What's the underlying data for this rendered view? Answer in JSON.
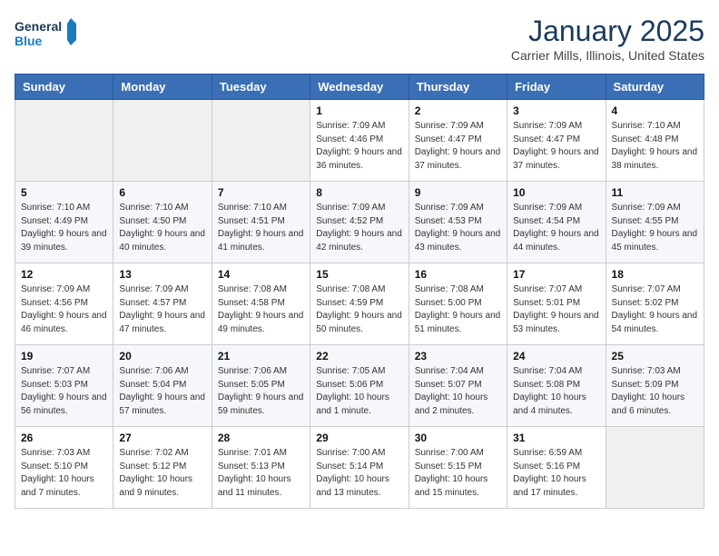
{
  "header": {
    "logo_line1": "General",
    "logo_line2": "Blue",
    "month_title": "January 2025",
    "location": "Carrier Mills, Illinois, United States"
  },
  "weekdays": [
    "Sunday",
    "Monday",
    "Tuesday",
    "Wednesday",
    "Thursday",
    "Friday",
    "Saturday"
  ],
  "weeks": [
    [
      {
        "day": "",
        "info": ""
      },
      {
        "day": "",
        "info": ""
      },
      {
        "day": "",
        "info": ""
      },
      {
        "day": "1",
        "info": "Sunrise: 7:09 AM\nSunset: 4:46 PM\nDaylight: 9 hours and 36 minutes."
      },
      {
        "day": "2",
        "info": "Sunrise: 7:09 AM\nSunset: 4:47 PM\nDaylight: 9 hours and 37 minutes."
      },
      {
        "day": "3",
        "info": "Sunrise: 7:09 AM\nSunset: 4:47 PM\nDaylight: 9 hours and 37 minutes."
      },
      {
        "day": "4",
        "info": "Sunrise: 7:10 AM\nSunset: 4:48 PM\nDaylight: 9 hours and 38 minutes."
      }
    ],
    [
      {
        "day": "5",
        "info": "Sunrise: 7:10 AM\nSunset: 4:49 PM\nDaylight: 9 hours and 39 minutes."
      },
      {
        "day": "6",
        "info": "Sunrise: 7:10 AM\nSunset: 4:50 PM\nDaylight: 9 hours and 40 minutes."
      },
      {
        "day": "7",
        "info": "Sunrise: 7:10 AM\nSunset: 4:51 PM\nDaylight: 9 hours and 41 minutes."
      },
      {
        "day": "8",
        "info": "Sunrise: 7:09 AM\nSunset: 4:52 PM\nDaylight: 9 hours and 42 minutes."
      },
      {
        "day": "9",
        "info": "Sunrise: 7:09 AM\nSunset: 4:53 PM\nDaylight: 9 hours and 43 minutes."
      },
      {
        "day": "10",
        "info": "Sunrise: 7:09 AM\nSunset: 4:54 PM\nDaylight: 9 hours and 44 minutes."
      },
      {
        "day": "11",
        "info": "Sunrise: 7:09 AM\nSunset: 4:55 PM\nDaylight: 9 hours and 45 minutes."
      }
    ],
    [
      {
        "day": "12",
        "info": "Sunrise: 7:09 AM\nSunset: 4:56 PM\nDaylight: 9 hours and 46 minutes."
      },
      {
        "day": "13",
        "info": "Sunrise: 7:09 AM\nSunset: 4:57 PM\nDaylight: 9 hours and 47 minutes."
      },
      {
        "day": "14",
        "info": "Sunrise: 7:08 AM\nSunset: 4:58 PM\nDaylight: 9 hours and 49 minutes."
      },
      {
        "day": "15",
        "info": "Sunrise: 7:08 AM\nSunset: 4:59 PM\nDaylight: 9 hours and 50 minutes."
      },
      {
        "day": "16",
        "info": "Sunrise: 7:08 AM\nSunset: 5:00 PM\nDaylight: 9 hours and 51 minutes."
      },
      {
        "day": "17",
        "info": "Sunrise: 7:07 AM\nSunset: 5:01 PM\nDaylight: 9 hours and 53 minutes."
      },
      {
        "day": "18",
        "info": "Sunrise: 7:07 AM\nSunset: 5:02 PM\nDaylight: 9 hours and 54 minutes."
      }
    ],
    [
      {
        "day": "19",
        "info": "Sunrise: 7:07 AM\nSunset: 5:03 PM\nDaylight: 9 hours and 56 minutes."
      },
      {
        "day": "20",
        "info": "Sunrise: 7:06 AM\nSunset: 5:04 PM\nDaylight: 9 hours and 57 minutes."
      },
      {
        "day": "21",
        "info": "Sunrise: 7:06 AM\nSunset: 5:05 PM\nDaylight: 9 hours and 59 minutes."
      },
      {
        "day": "22",
        "info": "Sunrise: 7:05 AM\nSunset: 5:06 PM\nDaylight: 10 hours and 1 minute."
      },
      {
        "day": "23",
        "info": "Sunrise: 7:04 AM\nSunset: 5:07 PM\nDaylight: 10 hours and 2 minutes."
      },
      {
        "day": "24",
        "info": "Sunrise: 7:04 AM\nSunset: 5:08 PM\nDaylight: 10 hours and 4 minutes."
      },
      {
        "day": "25",
        "info": "Sunrise: 7:03 AM\nSunset: 5:09 PM\nDaylight: 10 hours and 6 minutes."
      }
    ],
    [
      {
        "day": "26",
        "info": "Sunrise: 7:03 AM\nSunset: 5:10 PM\nDaylight: 10 hours and 7 minutes."
      },
      {
        "day": "27",
        "info": "Sunrise: 7:02 AM\nSunset: 5:12 PM\nDaylight: 10 hours and 9 minutes."
      },
      {
        "day": "28",
        "info": "Sunrise: 7:01 AM\nSunset: 5:13 PM\nDaylight: 10 hours and 11 minutes."
      },
      {
        "day": "29",
        "info": "Sunrise: 7:00 AM\nSunset: 5:14 PM\nDaylight: 10 hours and 13 minutes."
      },
      {
        "day": "30",
        "info": "Sunrise: 7:00 AM\nSunset: 5:15 PM\nDaylight: 10 hours and 15 minutes."
      },
      {
        "day": "31",
        "info": "Sunrise: 6:59 AM\nSunset: 5:16 PM\nDaylight: 10 hours and 17 minutes."
      },
      {
        "day": "",
        "info": ""
      }
    ]
  ]
}
